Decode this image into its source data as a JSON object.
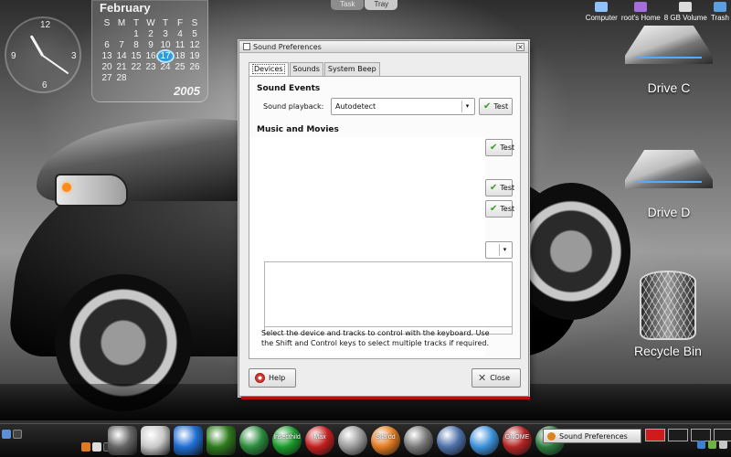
{
  "top_panel": {
    "tabs": [
      "Task",
      "Tray"
    ]
  },
  "clock_widget": {
    "numbers": [
      "12",
      "3",
      "6",
      "9"
    ]
  },
  "calendar": {
    "month": "February",
    "year": "2005",
    "weekdays": [
      "S",
      "M",
      "T",
      "W",
      "T",
      "F",
      "S"
    ],
    "days": [
      "",
      "",
      "1",
      "2",
      "3",
      "4",
      "5",
      "6",
      "7",
      "8",
      "9",
      "10",
      "11",
      "12",
      "13",
      "14",
      "15",
      "16",
      "17",
      "18",
      "19",
      "20",
      "21",
      "22",
      "23",
      "24",
      "25",
      "26",
      "27",
      "28",
      "",
      "",
      "",
      "",
      ""
    ],
    "today": "17"
  },
  "desktop_top_icons": [
    {
      "label": "Computer",
      "color": "#8fc1ff"
    },
    {
      "label": "root's Home",
      "color": "#a56fd9"
    },
    {
      "label": "8 GB Volume",
      "color": "#dcdcdc"
    },
    {
      "label": "Trash",
      "color": "#5a9fe0"
    }
  ],
  "drives": [
    {
      "label": "Drive C"
    },
    {
      "label": "Drive D"
    }
  ],
  "recycle_bin": {
    "label": "Recycle Bin"
  },
  "dialog": {
    "title": "Sound Preferences",
    "tabs": [
      "Devices",
      "Sounds",
      "System Beep"
    ],
    "active_tab": "Devices",
    "sound_events_title": "Sound Events",
    "sound_playback_label": "Sound playback:",
    "sound_playback_value": "Autodetect",
    "music_movies_title": "Music and Movies",
    "test_label": "Test",
    "help_text": "Select the device and tracks to control with the keyboard. Use the Shift and Control keys to select multiple tracks if required.",
    "help_button": "Help",
    "close_button": "Close"
  },
  "taskbar": {
    "dock_items": [
      "",
      "",
      "",
      "",
      "",
      "Insecthild",
      "Max",
      "",
      "Sila dd",
      "",
      "",
      "",
      "GNOME",
      ""
    ],
    "task_item": "Sound Preferences"
  },
  "colors": {
    "accent_blue": "#2d9bdc",
    "test_check": "#3a9d22",
    "workspace_active": "#d11a1a"
  }
}
